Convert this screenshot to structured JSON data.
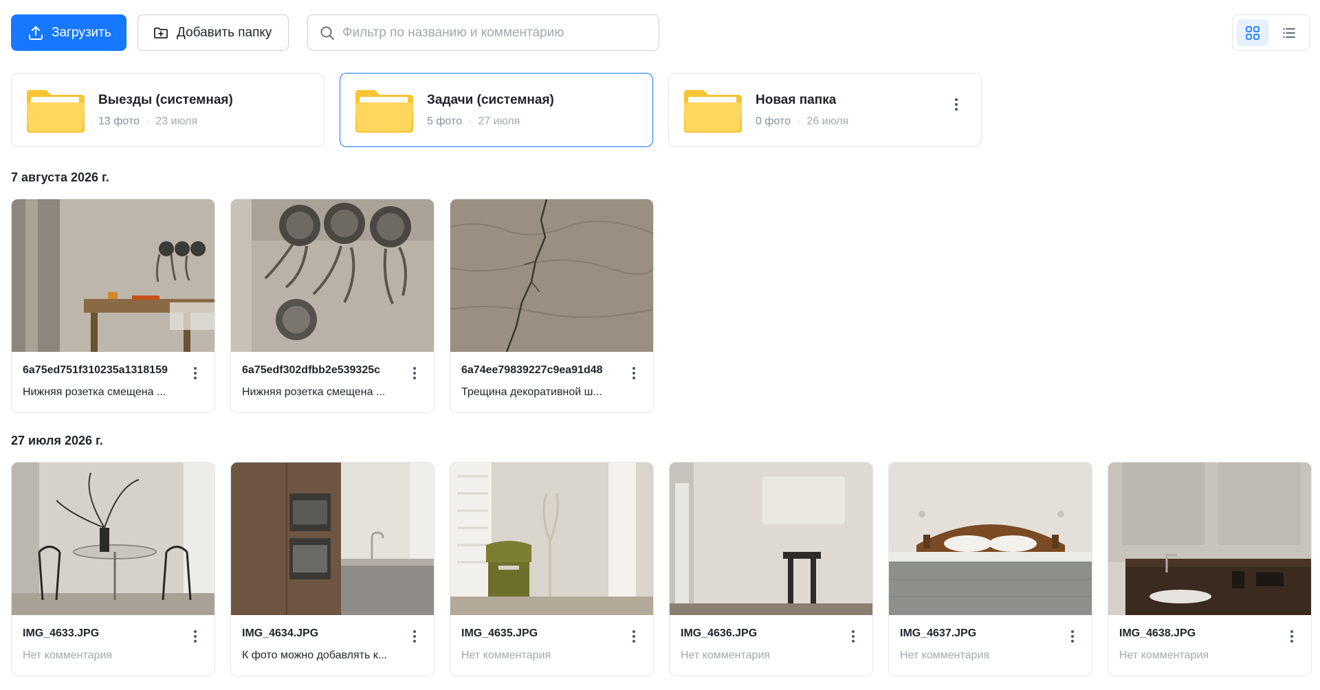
{
  "toolbar": {
    "upload_label": "Загрузить",
    "add_folder_label": "Добавить папку",
    "search_placeholder": "Фильтр по названию и комментарию",
    "active_view": "grid"
  },
  "colors": {
    "primary": "#1677ff",
    "folder_yellow": "#ffd75e",
    "folder_yellow_dark": "#f7c434",
    "border": "#e3e6ea",
    "muted_text": "#86909c"
  },
  "folders": [
    {
      "name": "Выезды (системная)",
      "count": "13 фото",
      "date": "23 июля",
      "selected": false,
      "has_menu": false
    },
    {
      "name": "Задачи (системная)",
      "count": "5 фото",
      "date": "27 июля",
      "selected": true,
      "has_menu": false
    },
    {
      "name": "Новая папка",
      "count": "0 фото",
      "date": "26 июля",
      "selected": false,
      "has_menu": true
    }
  ],
  "sections": [
    {
      "title": "7 августа 2026 г.",
      "photos": [
        {
          "name": "6a75ed751f310235a1318159",
          "comment": "Нижняя розетка смещена ...",
          "thumb": "construction-wall-photo"
        },
        {
          "name": "6a75edf302dfbb2e539325c",
          "comment": "Нижняя розетка смещена ...",
          "thumb": "electrical-boxes-photo"
        },
        {
          "name": "6a74ee79839227c9ea91d48",
          "comment": "Трещина декоративной ш...",
          "thumb": "cracked-plaster-photo"
        }
      ]
    },
    {
      "title": "27 июля 2026 г.",
      "photos": [
        {
          "name": "IMG_4633.JPG",
          "comment": "Нет комментария",
          "empty": true,
          "thumb": "dining-room-photo"
        },
        {
          "name": "IMG_4634.JPG",
          "comment": "К фото можно добавлять к...",
          "empty": false,
          "thumb": "kitchen-photo"
        },
        {
          "name": "IMG_4635.JPG",
          "comment": "Нет комментария",
          "empty": true,
          "thumb": "armchair-room-photo"
        },
        {
          "name": "IMG_4636.JPG",
          "comment": "Нет комментария",
          "empty": true,
          "thumb": "stool-room-photo"
        },
        {
          "name": "IMG_4637.JPG",
          "comment": "Нет комментария",
          "empty": true,
          "thumb": "bedroom-photo"
        },
        {
          "name": "IMG_4638.JPG",
          "comment": "Нет комментария",
          "empty": true,
          "thumb": "bathroom-photo"
        }
      ]
    }
  ]
}
